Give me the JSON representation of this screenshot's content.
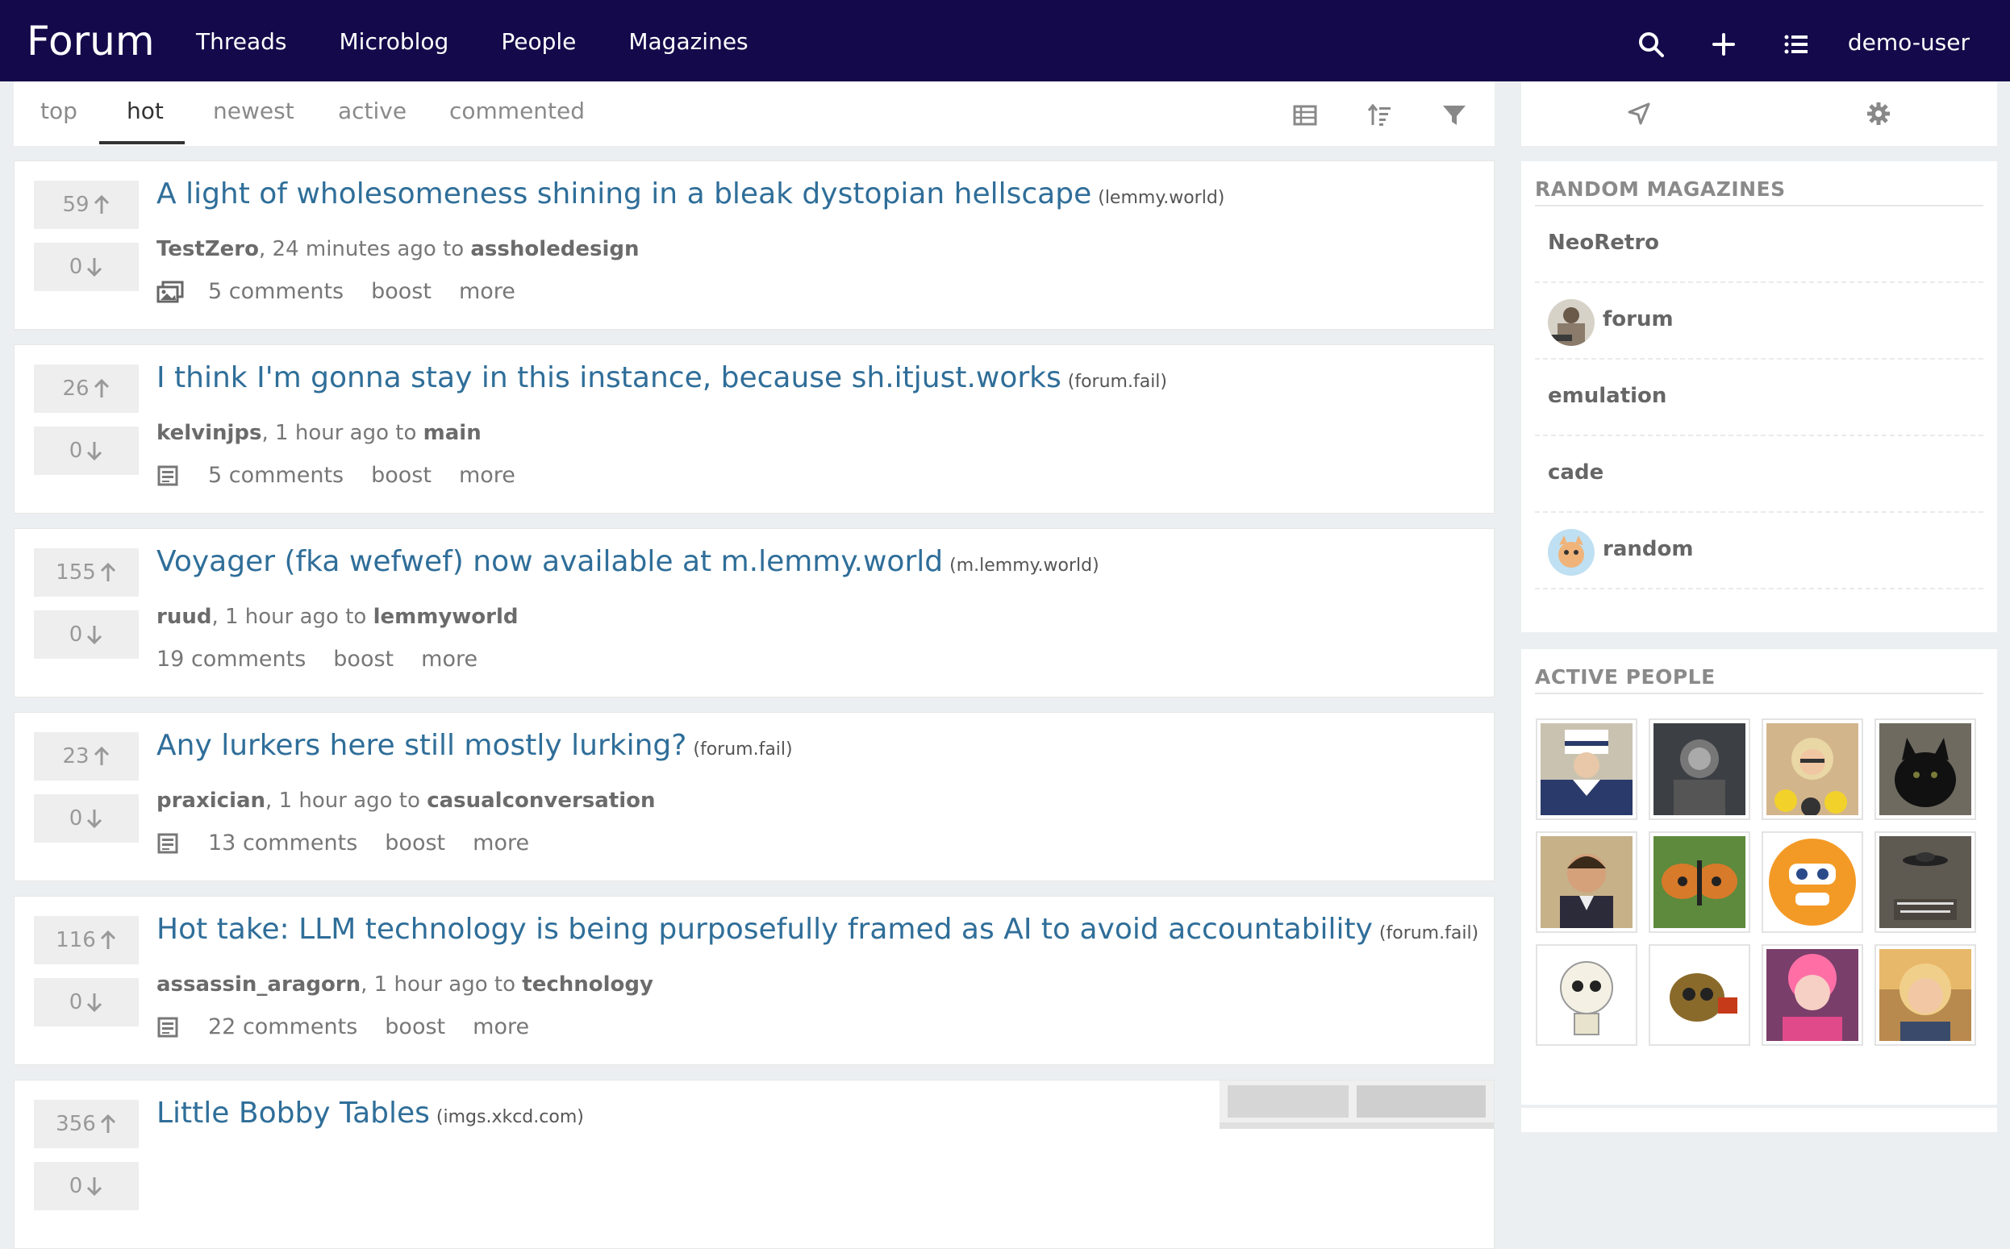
{
  "header": {
    "brand": "Forum",
    "nav": [
      "Threads",
      "Microblog",
      "People",
      "Magazines"
    ],
    "user": "demo-user",
    "icons": [
      "search-icon",
      "plus-icon",
      "list-icon"
    ]
  },
  "sort": {
    "tabs": [
      "top",
      "hot",
      "newest",
      "active",
      "commented"
    ],
    "active": "hot",
    "icons": [
      "layout-icon",
      "sort-icon",
      "filter-icon"
    ]
  },
  "sidebar": {
    "top_icons": [
      "send-icon",
      "settings-icon"
    ],
    "random_heading": "RANDOM MAGAZINES",
    "magazines": [
      "NeoRetro",
      "forum",
      "emulation",
      "cade",
      "random"
    ],
    "people_heading": "ACTIVE PEOPLE"
  },
  "posts": [
    {
      "up": "59",
      "down": "0",
      "title": "A light of wholesomeness shining in a bleak dystopian hellscape",
      "domain": "(lemmy.world)",
      "author": "TestZero",
      "time": ", 24 minutes ago to ",
      "magazine": "assholedesign",
      "comments": "5 comments",
      "boost": "boost",
      "more": "more",
      "icon": "gallery-icon"
    },
    {
      "up": "26",
      "down": "0",
      "title": "I think I'm gonna stay in this instance, because sh.itjust.works",
      "domain": "(forum.fail)",
      "author": "kelvinjps",
      "time": ", 1 hour ago to ",
      "magazine": "main",
      "comments": "5 comments",
      "boost": "boost",
      "more": "more",
      "icon": "article-icon"
    },
    {
      "up": "155",
      "down": "0",
      "title": "Voyager (fka wefwef) now available at m.lemmy.world",
      "domain": "(m.lemmy.world)",
      "author": "ruud",
      "time": ", 1 hour ago to ",
      "magazine": "lemmyworld",
      "comments": "19 comments",
      "boost": "boost",
      "more": "more",
      "icon": ""
    },
    {
      "up": "23",
      "down": "0",
      "title": "Any lurkers here still mostly lurking?",
      "domain": "(forum.fail)",
      "author": "praxician",
      "time": ", 1 hour ago to ",
      "magazine": "casualconversation",
      "comments": "13 comments",
      "boost": "boost",
      "more": "more",
      "icon": "article-icon"
    },
    {
      "up": "116",
      "down": "0",
      "title": "Hot take: LLM technology is being purposefully framed as AI to avoid accountability",
      "domain": "(forum.fail)",
      "author": "assassin_aragorn",
      "time": ", 1 hour ago to ",
      "magazine": "technology",
      "comments": "22 comments",
      "boost": "boost",
      "more": "more",
      "icon": "article-icon"
    },
    {
      "up": "356",
      "down": "0",
      "title": "Little Bobby Tables",
      "domain": "(imgs.xkcd.com)",
      "author": "",
      "time": "",
      "magazine": "",
      "comments": "",
      "boost": "",
      "more": "",
      "icon": ""
    }
  ]
}
